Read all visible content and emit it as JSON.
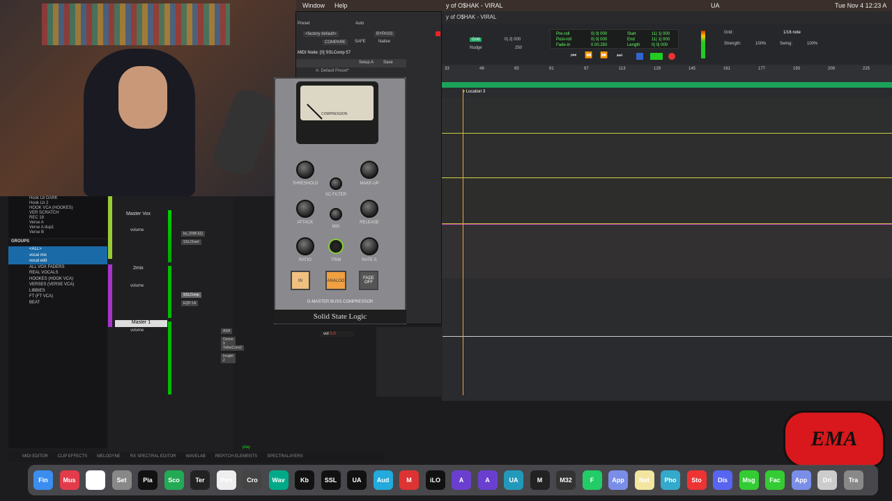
{
  "menubar": {
    "window": "Window",
    "help": "Help",
    "ua": "UA",
    "clock": "Tue Nov 4  12:23 A",
    "session_title": "y of O$HAK - VIRAL"
  },
  "plugin": {
    "preset_label": "Preset",
    "auto_label": "Auto",
    "factory_default": "<factory default>",
    "bypass": "BYPASS",
    "compare": "COMPARE",
    "safe": "SAFE",
    "native": "Native",
    "midi_node": "MIDI Node: [0] SSLComp 57",
    "preset_name": "A: Default Preset*",
    "setup_a": "Setup A",
    "save": "Save",
    "meter_label": "COMPRESSION",
    "knobs": {
      "threshold": "THRESHOLD",
      "makeup": "MAKE-UP",
      "scfilter": "SC FILTER",
      "attack": "ATTACK",
      "release": "RELEASE",
      "mix": "MIX",
      "ratio": "RATIO",
      "trim": "TRIM",
      "rate_s": "RATE-S"
    },
    "buttons": {
      "in": "IN",
      "analog": "ANALOG",
      "fade_off": "FADE OFF"
    },
    "model": "G-MASTER BUSS COMPRESSOR",
    "brand": "Solid State Logic"
  },
  "transport": {
    "grid_label": "Grid:",
    "grid_value": "1/16 note",
    "nudge_label": "Nudge",
    "nudge_value": "250",
    "strength_label": "Strength:",
    "strength_value": "100%",
    "swing_label": "Swing:",
    "swing_value": "100%",
    "preroll": "Pre-roll",
    "postroll": "Post-roll",
    "fadein": "Fade-in",
    "preroll_val": "0| 0| 000",
    "postroll_val": "0| 0| 000",
    "fadein_val": "0.00.250",
    "start": "Start",
    "end": "End",
    "length": "Length",
    "start_val": "11| 1| 000",
    "end_val": "11| 1| 000",
    "length_val": "0| 0| 000",
    "counter": "0| 2| 000"
  },
  "ruler": {
    "bars": [
      "33",
      "49",
      "65",
      "81",
      "97",
      "113",
      "129",
      "145",
      "161",
      "177",
      "193",
      "209",
      "225"
    ],
    "marker": "Location 3"
  },
  "tracks_top": [
    "Hook Lb DARK",
    "Hook Lb 2",
    "HOOK VCA (HOOKES)",
    "VER SCRATCH",
    "REC 18",
    "Verse A",
    "Verse A dup1",
    "Verse B"
  ],
  "groups": {
    "title": "GROUPS",
    "items": [
      "<ALL>",
      "vocal mix",
      "vocal edit",
      "ALL VOX FADERS",
      "REAL VOCALS",
      "HOOKES (HOOK VCA)",
      "VERSES (VERSE VCA)",
      "LIBBIES",
      "FT (FT VCA)",
      "BEAT"
    ]
  },
  "mixer": {
    "ch1": "Master Vox",
    "ch2": "2mix",
    "ch3": "Master 1",
    "volume": "volume",
    "ins1": "bx_2098 EQ",
    "ins2": "SSLChanl",
    "ins3": "SSLComp",
    "ins4": "EQP-1A",
    "ins5": "ASH",
    "ins6": "Ozone 9",
    "ins7": "ToBeiConv2",
    "ins8": "Insight 2",
    "vol": "vol",
    "vol_val": "0.0",
    "play": "play"
  },
  "bottom": [
    "MIDI EDITOR",
    "CLIP EFFECTS",
    "MELODYNE",
    "RX SPECTRAL EDITOR",
    "WAVELAB",
    "REPITCH ELEMENTS",
    "SPECTRALAYERS"
  ],
  "dock": [
    "Finder",
    "Music",
    "Chrome",
    "Settings",
    "Piano",
    "Scope",
    "Terminal",
    "Pen",
    "Crop",
    "Wave",
    "Kb",
    "SSL",
    "UA",
    "Audio",
    "M",
    "iLOK",
    "A",
    "A",
    "UA",
    "M",
    "M32",
    "F",
    "App",
    "Notes",
    "Photos",
    "Stop",
    "Discord",
    "Msg",
    "Facetime",
    "App",
    "Drive",
    "Trash"
  ],
  "colors": {
    "accent": "#2fbf3a",
    "gold": "#e6a94a",
    "purple": "#b040c0",
    "yellow": "#c8d040"
  }
}
